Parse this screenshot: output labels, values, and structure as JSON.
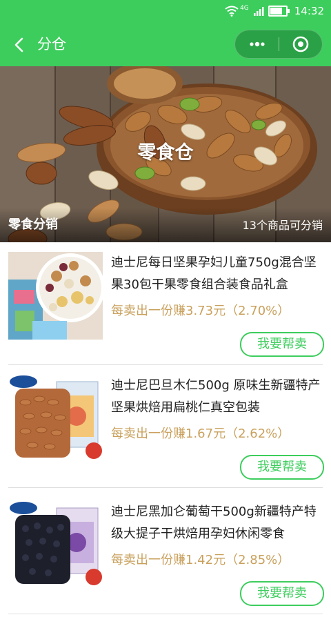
{
  "status_bar": {
    "network": "4G",
    "time": "14:32",
    "battery_level": 0.85
  },
  "navbar": {
    "title": "分仓"
  },
  "banner": {
    "title": "零食仓",
    "left_label": "零食分销",
    "right_label": "13个商品可分销"
  },
  "products": [
    {
      "name": "迪士尼每日坚果孕妇儿童750g混合坚果30包干果零食组合装食品礼盒",
      "earn": "每卖出一份赚3.73元（2.70%）",
      "button": "我要帮卖"
    },
    {
      "name": "迪士尼巴旦木仁500g 原味生新疆特产坚果烘焙用扁桃仁真空包装",
      "earn": "每卖出一份赚1.67元（2.62%）",
      "button": "我要帮卖"
    },
    {
      "name": "迪士尼黑加仑葡萄干500g新疆特产特级大提子干烘焙用孕妇休闲零食",
      "earn": "每卖出一份赚1.42元（2.85%）",
      "button": "我要帮卖"
    }
  ],
  "colors": {
    "brand_green": "#3dcd5d",
    "earn_gold": "#c9a15d"
  }
}
